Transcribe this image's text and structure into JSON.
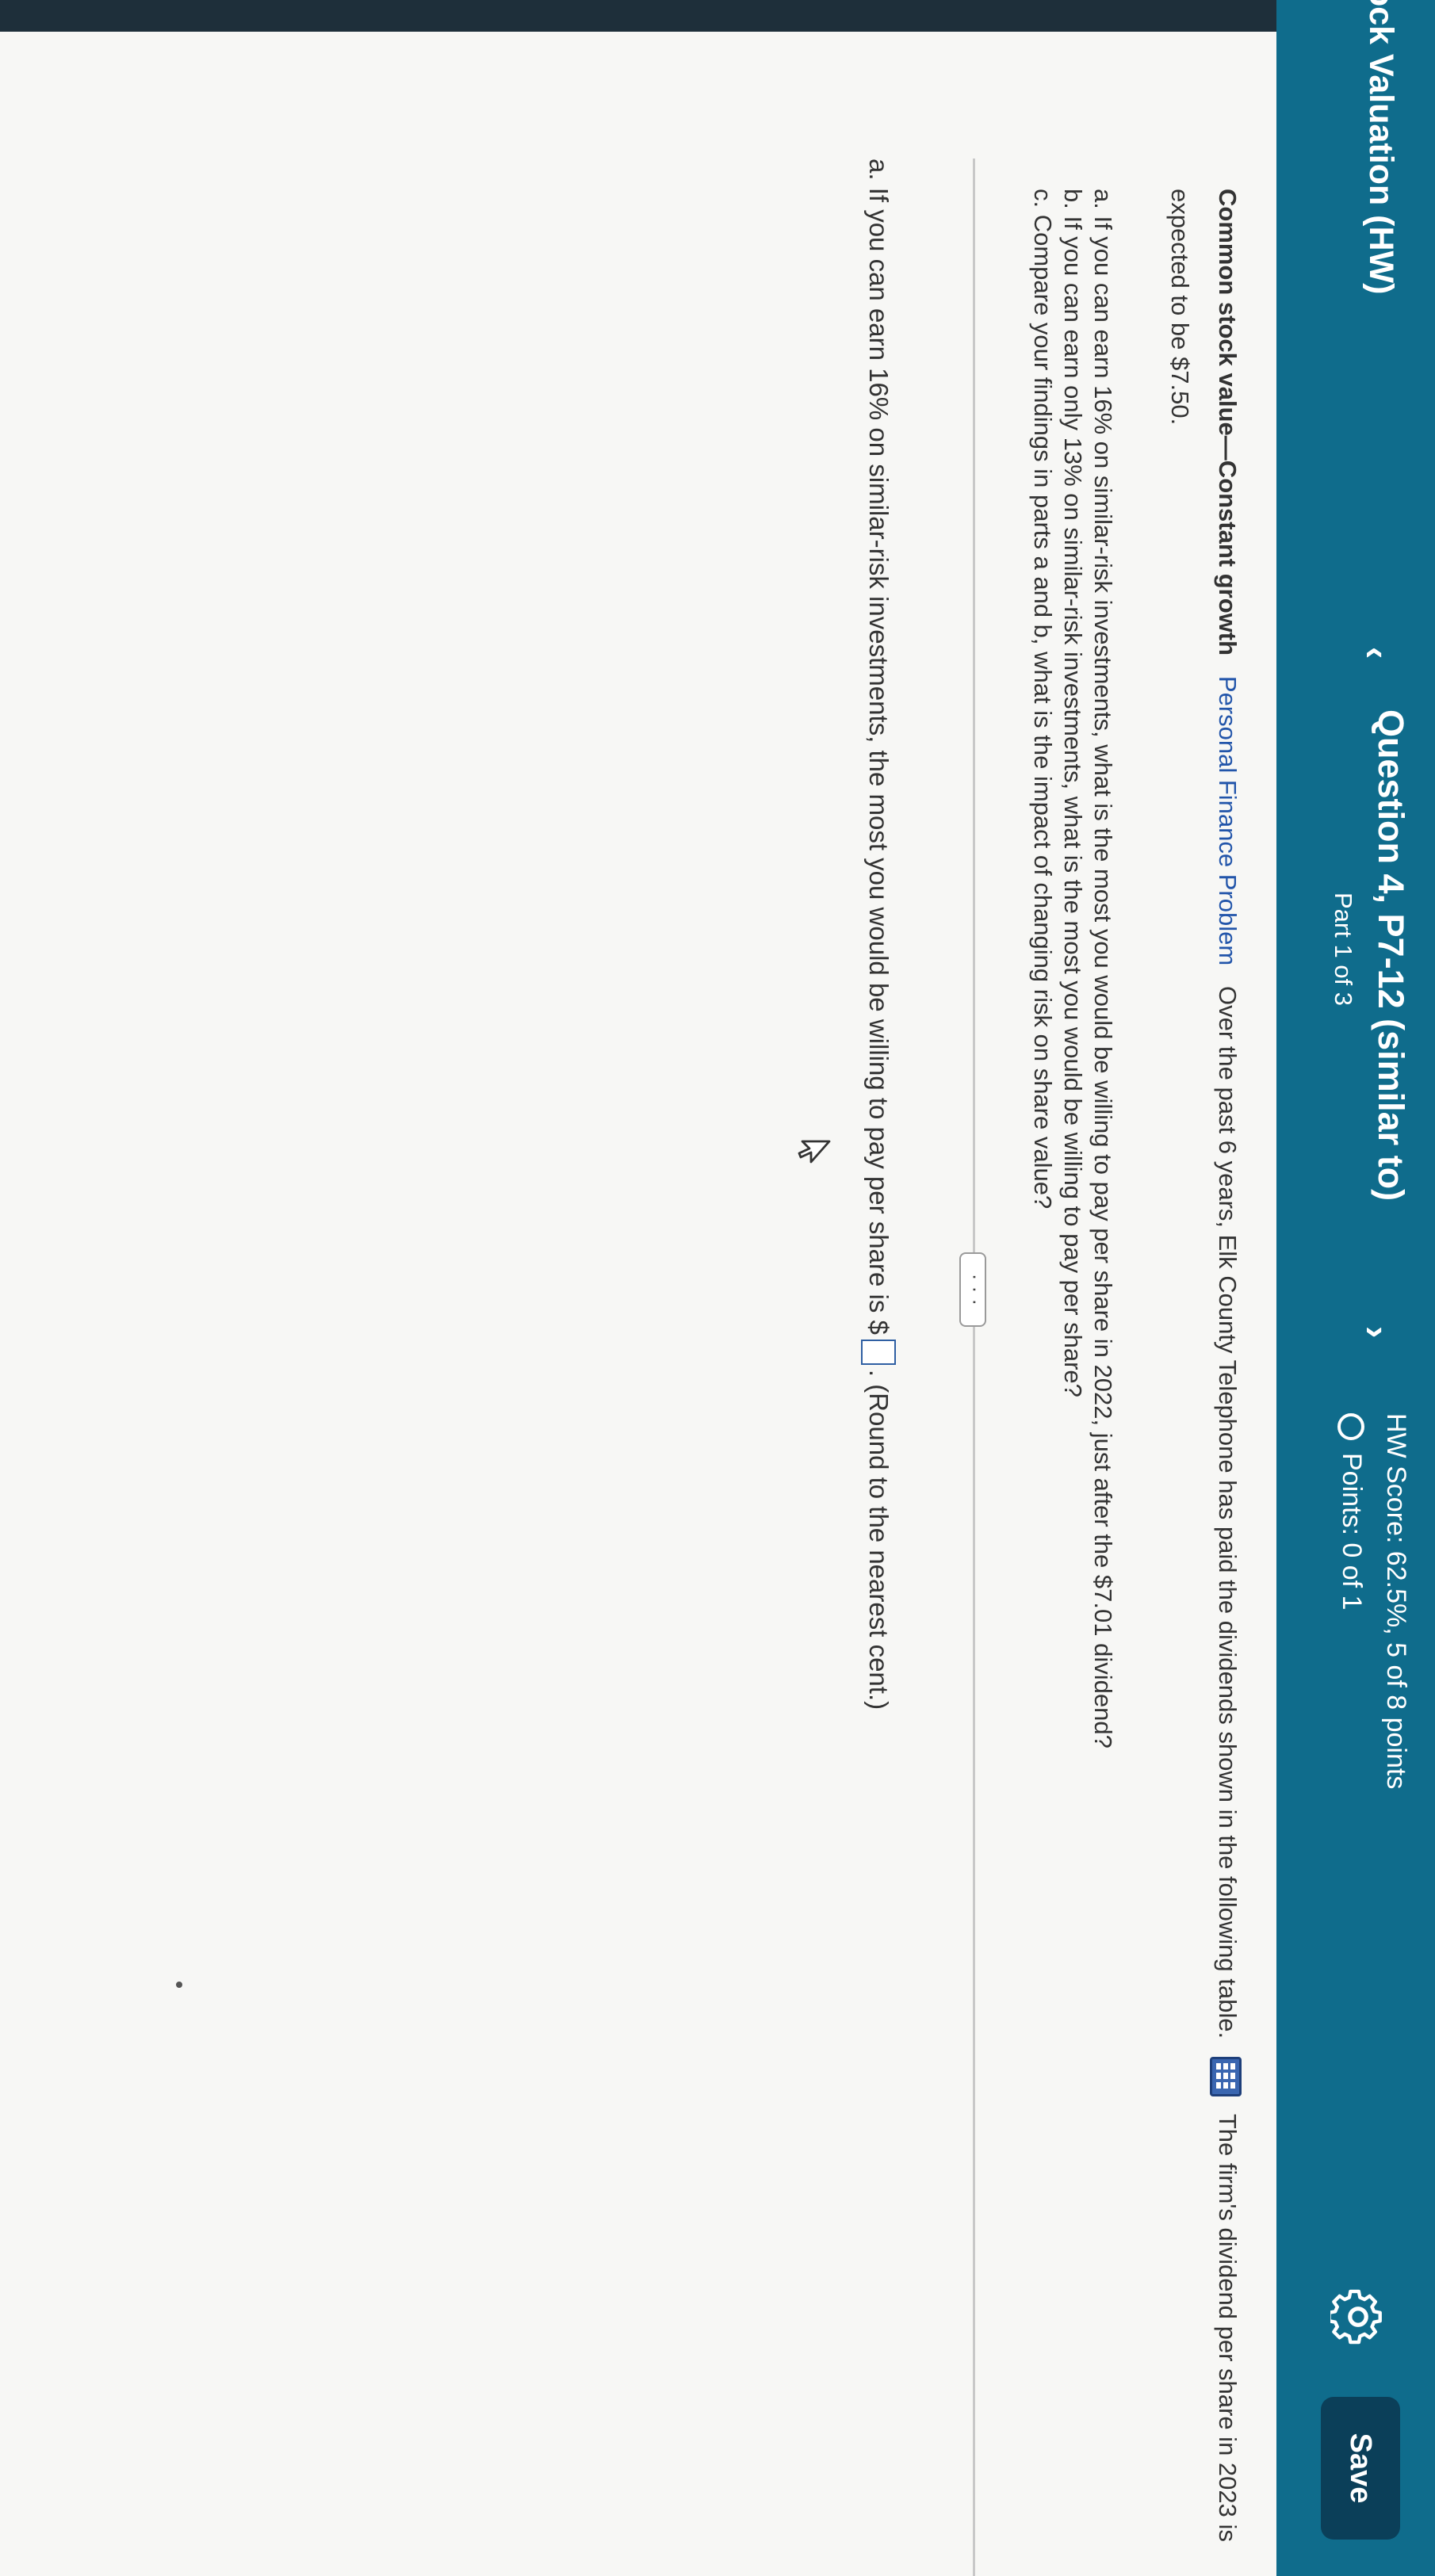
{
  "header": {
    "section_title": "ock Valuation (HW)",
    "question_title": "Question 4, P7-12 (similar to)",
    "question_part": "Part 1 of 3",
    "score": "HW Score: 62.5%, 5 of 8 points",
    "points": "Points: 0 of 1",
    "save_label": "Save",
    "icons": {
      "prev": "chevron-left-icon",
      "next": "chevron-right-icon",
      "settings": "gear-icon",
      "points_status": "circle-icon"
    },
    "colors": {
      "bar": "#0f6c8c",
      "save_button": "#0b3f59"
    }
  },
  "problem": {
    "heading": "Common stock value—Constant growth",
    "topic": "Personal Finance Problem",
    "text_before_icon": "Over the past 6 years, Elk County Telephone has paid the dividends shown in the following table.",
    "text_after_icon": "The firm's dividend per share in 2023 is expected to be $7.50.",
    "table_icon": "data-table-icon"
  },
  "questions": [
    "a.  If you can earn 16% on similar-risk investments, what is the most you would be willing to pay per share in 2022, just after the $7.01 dividend?",
    "b.  If you can earn only 13% on similar-risk investments, what is the most you would be willing to pay per share?",
    "c.  Compare your findings in parts a and b, what is the impact of changing risk on share value?"
  ],
  "ellipsis": "· · ·",
  "answer": {
    "prefix": "a.  If you can earn 16% on similar-risk investments, the most you would be willing to pay per share is $",
    "input_value": "",
    "suffix": ".  (Round to the nearest cent.)"
  }
}
